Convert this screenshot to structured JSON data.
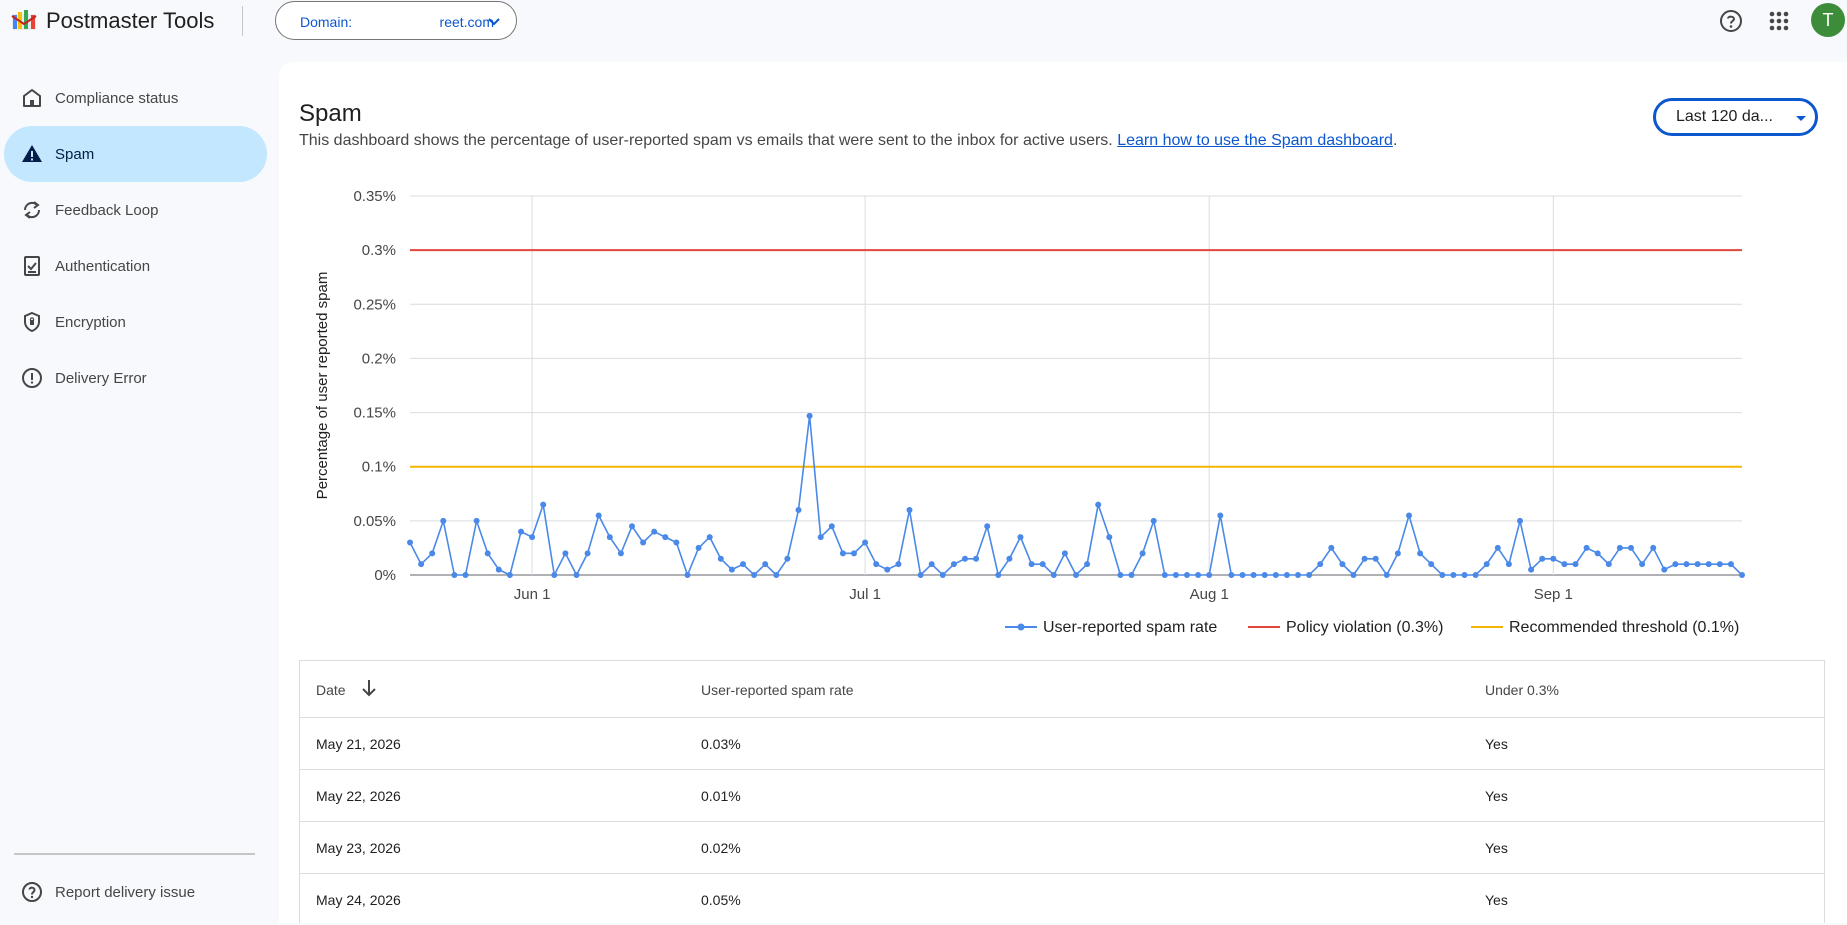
{
  "header": {
    "app_title": "Postmaster Tools",
    "domain_label": "Domain:",
    "domain_value": "reet.com",
    "user_initial": "T"
  },
  "sidebar": {
    "items": [
      {
        "label": "Compliance status",
        "icon": "home-icon"
      },
      {
        "label": "Spam",
        "icon": "warning-icon",
        "active": true
      },
      {
        "label": "Feedback Loop",
        "icon": "sync-icon"
      },
      {
        "label": "Authentication",
        "icon": "checklist-icon"
      },
      {
        "label": "Encryption",
        "icon": "shield-icon"
      },
      {
        "label": "Delivery Error",
        "icon": "error-icon"
      }
    ],
    "report_label": "Report delivery issue"
  },
  "main": {
    "title": "Spam",
    "description": "This dashboard shows the percentage of user-reported spam vs emails that were sent to the inbox for active users.",
    "learn_link": "Learn how to use the Spam dashboard",
    "desc_period": ".",
    "range_selected": "Last 120 da..."
  },
  "colors": {
    "series": "#4a89e8",
    "policy": "#e2453b",
    "threshold": "#f4b400",
    "accent": "#0b57d0"
  },
  "chart_data": {
    "type": "line",
    "ylabel": "Percentage of user reported spam",
    "ylim": [
      0,
      0.35
    ],
    "y_ticks": [
      "0%",
      "0.05%",
      "0.1%",
      "0.15%",
      "0.2%",
      "0.25%",
      "0.3%",
      "0.35%"
    ],
    "x_ticks": [
      "Jun 1",
      "Jul 1",
      "Aug 1",
      "Sep 1"
    ],
    "x_start": "May 21, 2026",
    "legend_position": "bottom-right",
    "grid": true,
    "series": [
      {
        "name": "User-reported spam rate",
        "values": [
          0.03,
          0.01,
          0.02,
          0.05,
          0,
          0,
          0.05,
          0.02,
          0.005,
          0,
          0.04,
          0.035,
          0.065,
          0,
          0.02,
          0,
          0.02,
          0.055,
          0.035,
          0.02,
          0.045,
          0.03,
          0.04,
          0.035,
          0.03,
          0,
          0.025,
          0.035,
          0.015,
          0.005,
          0.01,
          0,
          0.01,
          0,
          0.015,
          0.06,
          0.147,
          0.035,
          0.045,
          0.02,
          0.02,
          0.03,
          0.01,
          0.005,
          0.01,
          0.06,
          0,
          0.01,
          0,
          0.01,
          0.015,
          0.015,
          0.045,
          0,
          0.015,
          0.035,
          0.01,
          0.01,
          0,
          0.02,
          0,
          0.01,
          0.065,
          0.035,
          0,
          0,
          0.02,
          0.05,
          0,
          0,
          0,
          0,
          0,
          0.055,
          0,
          0,
          0,
          0,
          0,
          0,
          0,
          0,
          0.01,
          0.025,
          0.01,
          0,
          0.015,
          0.015,
          0,
          0.02,
          0.055,
          0.02,
          0.01,
          0,
          0,
          0,
          0,
          0.01,
          0.025,
          0.01,
          0.05,
          0.005,
          0.015,
          0.015,
          0.01,
          0.01,
          0.025,
          0.02,
          0.01,
          0.025,
          0.025,
          0.01,
          0.025,
          0.005,
          0.01,
          0.01,
          0.01,
          0.01,
          0.01,
          0.01,
          0
        ]
      }
    ],
    "reference_lines": [
      {
        "name": "Policy violation (0.3%)",
        "value": 0.3
      },
      {
        "name": "Recommended threshold (0.1%)",
        "value": 0.1
      }
    ]
  },
  "table": {
    "headers": [
      "Date",
      "User-reported spam rate",
      "Under 0.3%"
    ],
    "rows": [
      [
        "May 21, 2026",
        "0.03%",
        "Yes"
      ],
      [
        "May 22, 2026",
        "0.01%",
        "Yes"
      ],
      [
        "May 23, 2026",
        "0.02%",
        "Yes"
      ],
      [
        "May 24, 2026",
        "0.05%",
        "Yes"
      ]
    ]
  }
}
